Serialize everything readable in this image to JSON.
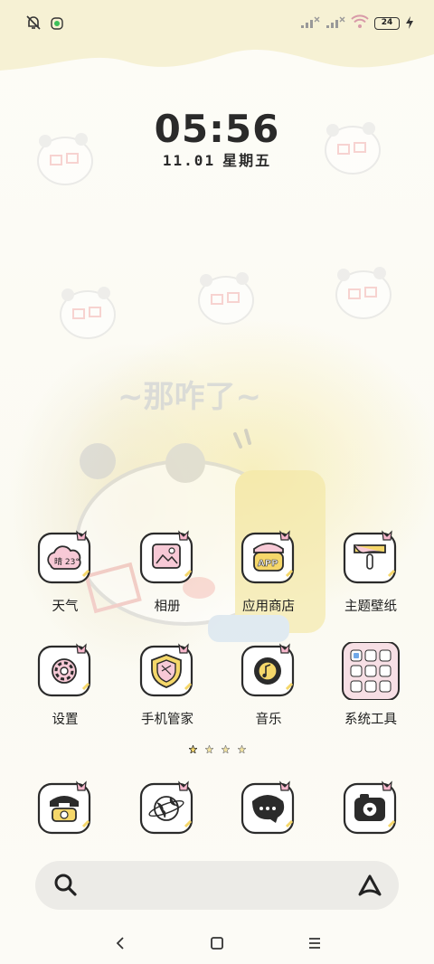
{
  "status_bar": {
    "battery_level": "24",
    "icons": [
      "bell-muted-icon",
      "app-indicator-icon",
      "signal-1-icon",
      "signal-2-icon",
      "wifi-icon",
      "battery-icon",
      "charging-icon"
    ]
  },
  "lockclock": {
    "hours": "05",
    "minutes": "56",
    "date": "11.01",
    "weekday": "星期五"
  },
  "apps": [
    {
      "label": "天气",
      "icon": "weather-icon",
      "badge": "晴 23°"
    },
    {
      "label": "相册",
      "icon": "gallery-icon"
    },
    {
      "label": "应用商店",
      "icon": "app-store-icon",
      "badge": "APP"
    },
    {
      "label": "主题壁纸",
      "icon": "themes-icon"
    },
    {
      "label": "设置",
      "icon": "settings-icon"
    },
    {
      "label": "手机管家",
      "icon": "security-icon"
    },
    {
      "label": "音乐",
      "icon": "music-icon"
    },
    {
      "label": "系统工具",
      "icon": "folder-icon"
    }
  ],
  "dock": [
    {
      "icon": "phone-icon"
    },
    {
      "icon": "browser-icon"
    },
    {
      "icon": "messages-icon"
    },
    {
      "icon": "camera-icon"
    }
  ],
  "page_indicator": {
    "pages": 4,
    "active": 0
  },
  "wallpaper_text": "~那咋了~",
  "colors": {
    "accent_pink": "#f4a9c0",
    "accent_yellow": "#f5d76a",
    "icon_bg": "#ffffff",
    "outline": "#2b2b2b"
  }
}
